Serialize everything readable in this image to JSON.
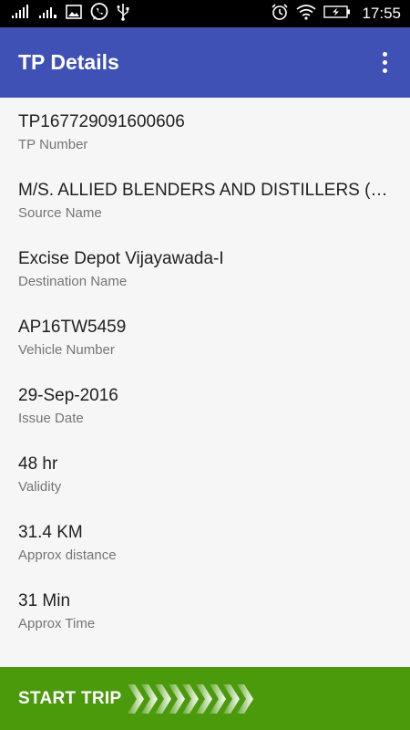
{
  "status_bar": {
    "time": "17:55",
    "icons": [
      "signal-bars-icon",
      "signal-bars-2-icon",
      "image-icon",
      "whatsapp-icon",
      "usb-icon",
      "alarm-icon",
      "wifi-icon",
      "battery-icon"
    ]
  },
  "app_bar": {
    "title": "TP Details",
    "menu_icon": "more-vert-icon"
  },
  "fields": [
    {
      "value": "TP167729091600606",
      "label": "TP Number"
    },
    {
      "value": "M/S. ALLIED BLENDERS AND DISTILLERS (P…",
      "label": "Source Name"
    },
    {
      "value": "Excise Depot Vijayawada-I",
      "label": "Destination Name"
    },
    {
      "value": "AP16TW5459",
      "label": "Vehicle Number"
    },
    {
      "value": "29-Sep-2016",
      "label": "Issue Date"
    },
    {
      "value": "48 hr",
      "label": "Validity"
    },
    {
      "value": "31.4 KM",
      "label": "Approx distance"
    },
    {
      "value": "31 Min",
      "label": "Approx Time"
    }
  ],
  "bottom_action": {
    "label": "START TRIP",
    "icon": "chevrons-right-icon",
    "color": "#4b9a0c"
  },
  "colors": {
    "app_bar": "#3f51b5",
    "status_bar": "#000000",
    "background": "#f6f6f6",
    "value_text": "#212121",
    "label_text": "#757575"
  }
}
